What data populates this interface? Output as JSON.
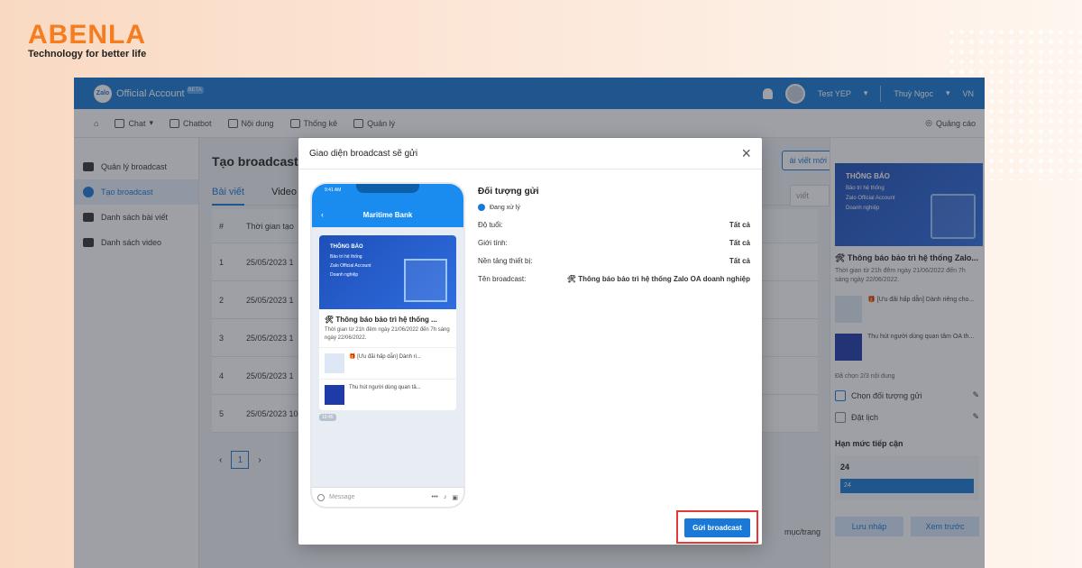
{
  "brand": {
    "name": "ABENLA",
    "tagline": "Technology for better life"
  },
  "topbar": {
    "app_title": "Official Account",
    "beta": "BETA",
    "zalo": "Zalo",
    "account": "Test YEP",
    "user": "Thuỳ Ngọc",
    "lang": "VN"
  },
  "nav": {
    "items": [
      {
        "label": "Chat"
      },
      {
        "label": "Chatbot"
      },
      {
        "label": "Nội dung"
      },
      {
        "label": "Thống kê"
      },
      {
        "label": "Quản lý"
      }
    ],
    "right": "Quảng cáo"
  },
  "sidebar": {
    "items": [
      {
        "label": "Quản lý broadcast"
      },
      {
        "label": "Tạo broadcast"
      },
      {
        "label": "Danh sách bài viết"
      },
      {
        "label": "Danh sách video"
      }
    ]
  },
  "main": {
    "title": "Tạo broadcast",
    "new_button": "ài viết mới",
    "search_placeholder": "viết",
    "tabs": [
      "Bài viết",
      "Video"
    ],
    "headers": [
      "#",
      "Thời gian tạo"
    ],
    "rows": [
      {
        "n": "1",
        "t": "25/05/2023 1"
      },
      {
        "n": "2",
        "t": "25/05/2023 1"
      },
      {
        "n": "3",
        "t": "25/05/2023 1"
      },
      {
        "n": "4",
        "t": "25/05/2023 1"
      },
      {
        "n": "5",
        "t": "25/05/2023 10"
      }
    ],
    "page": "1",
    "per_page": "mục/trang"
  },
  "right_panel": {
    "banner_head": "THÔNG BÁO",
    "banner_lines": [
      "Bảo trì hệ thống",
      "Zalo Official Account",
      "Doanh nghiệp"
    ],
    "post_title": "🛠 Thông báo bảo trì hệ thống Zalo...",
    "post_desc": "Thời gian từ 21h đêm ngày 21/06/2022 đến 7h sáng ngày 22/06/2022.",
    "items": [
      "🎁 [Ưu đãi hấp dẫn] Dành riêng cho...",
      "Thu hút người dùng quan tâm OA th..."
    ],
    "selected_count": "Đã chọn 2/3 nội dung",
    "choose_target": "Chọn đối tượng gửi",
    "schedule": "Đặt lịch",
    "limit_title": "Hạn mức tiếp cận",
    "limit_value": "24",
    "limit_bar": "24",
    "save_draft": "Lưu nháp",
    "preview": "Xem trước"
  },
  "modal": {
    "title": "Giao diện broadcast sẽ gửi",
    "phone": {
      "time": "9:41 AM",
      "header": "Maritime Bank",
      "banner_head": "THÔNG BÁO",
      "banner_lines": [
        "Bảo trì hệ thống",
        "Zalo Official Account",
        "Doanh nghiệp"
      ],
      "post_title": "🛠 Thông báo bảo trì hệ thống ...",
      "post_desc": "Thời gian từ 21h đêm ngày 21/06/2022 đến 7h sáng ngày 22/06/2022.",
      "items": [
        "🎁 [Ưu đãi hấp dẫn] Dành ri...",
        "Thu hút người dùng quan tâ..."
      ],
      "timestamp": "12:45",
      "input_placeholder": "Message"
    },
    "info": {
      "title": "Đối tượng gửi",
      "status": "Đang xử lý",
      "rows": [
        {
          "label": "Độ tuổi:",
          "value": "Tất cả"
        },
        {
          "label": "Giới tính:",
          "value": "Tất cả"
        },
        {
          "label": "Nền tảng thiết bị:",
          "value": "Tất cả"
        },
        {
          "label": "Tên broadcast:",
          "value": "🛠 Thông báo bảo trì hệ thống Zalo OA doanh nghiệp"
        }
      ]
    },
    "send_button": "Gửi broadcast"
  }
}
